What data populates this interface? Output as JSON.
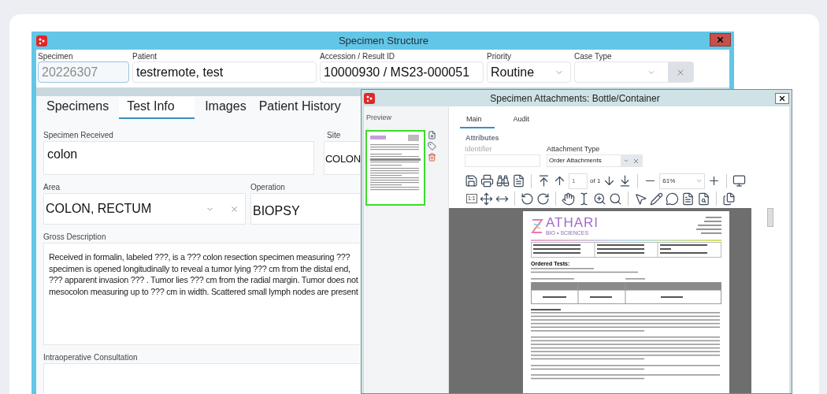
{
  "main_window": {
    "title": "Specimen Structure",
    "header_fields": [
      {
        "label": "Specimen",
        "value": "20226307",
        "kind": "text",
        "disabled": true
      },
      {
        "label": "Patient",
        "value": "testremote, test",
        "kind": "text",
        "disabled": false
      },
      {
        "label": "Accession / Result ID",
        "value": "10000930 / MS23-000051",
        "kind": "text",
        "disabled": false
      },
      {
        "label": "Priority",
        "value": "Routine",
        "kind": "dropdown",
        "disabled": false
      },
      {
        "label": "Case Type",
        "kind": "dropdown_clear",
        "disabled": false
      }
    ],
    "tabs": [
      {
        "label": "Specimens",
        "selected": false
      },
      {
        "label": "Test Info",
        "selected": true
      },
      {
        "label": "Images",
        "selected": false
      },
      {
        "label": "Patient History",
        "selected": false
      }
    ],
    "specimen_received": {
      "label": "Specimen Received",
      "value": "colon"
    },
    "site": {
      "label": "Site",
      "value": "COLON"
    },
    "area": {
      "label": "Area",
      "value": "COLON, RECTUM"
    },
    "operation": {
      "label": "Operation",
      "value": "BIOPSY"
    },
    "gross_description": {
      "label": "Gross Description",
      "lines": [
        "Received in formalin, labeled ???, is a ??? colon resection specimen measuring ???",
        "specimen is opened longitudinally to reveal a tumor lying ??? cm from the distal end,",
        "??? apparent invasion ??? . Tumor lies ??? cm from the radial margin. Tumor does not",
        "mesocolon measuring up to ??? cm in width. Scattered small lymph nodes are present"
      ]
    },
    "intraoperative_consultation": {
      "label": "Intraoperative Consultation"
    }
  },
  "attachments_window": {
    "title": "Specimen Attachments: Bottle/Container",
    "preview_label": "Preview",
    "tabs": [
      {
        "label": "Main",
        "selected": true
      },
      {
        "label": "Audit",
        "selected": false
      }
    ],
    "section": "Attributes",
    "identifier": {
      "label": "Identifier",
      "disabled": true
    },
    "attachment_type": {
      "label": "Attachment Type",
      "value": "Order Attachments"
    },
    "page_number": "1",
    "page_total": "of 1",
    "zoom": "61%",
    "actual_size": "1:1",
    "document": {
      "logo_name": "ATHARI",
      "logo_sub": "BIO • SCIENCES",
      "ordered_heading": "Ordered Tests:"
    }
  }
}
